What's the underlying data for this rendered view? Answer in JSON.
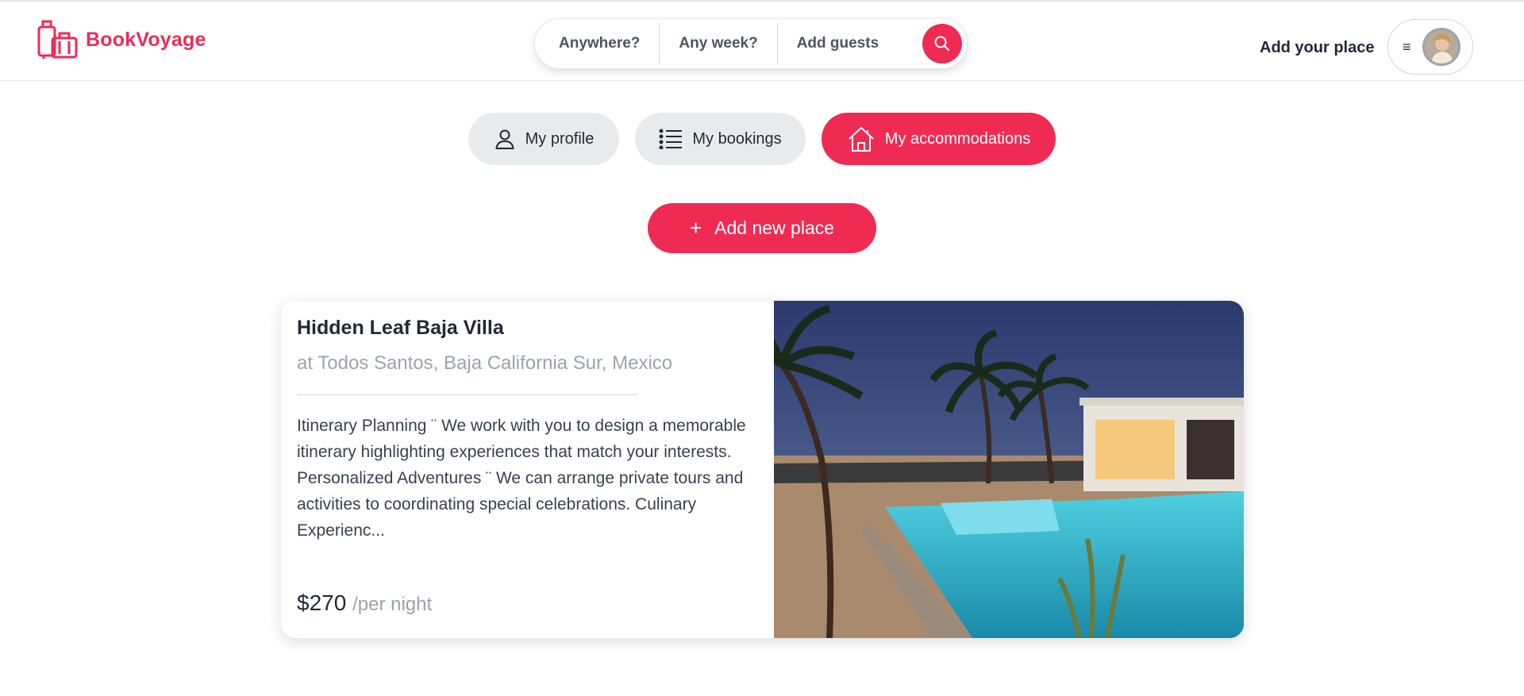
{
  "brand": {
    "name": "BookVoyage",
    "color": "#ef2b54"
  },
  "search": {
    "where": "Anywhere?",
    "when": "Any week?",
    "guests": "Add guests",
    "icon": "search-icon"
  },
  "header": {
    "add_place_link": "Add your place",
    "menu_icon": "≡"
  },
  "tabs": [
    {
      "label": "My profile",
      "icon": "user-icon",
      "active": false
    },
    {
      "label": "My bookings",
      "icon": "list-icon",
      "active": false
    },
    {
      "label": "My accommodations",
      "icon": "home-icon",
      "active": true
    }
  ],
  "add_new": {
    "label": "Add new place",
    "icon": "plus-icon",
    "symbol": "+"
  },
  "listing": {
    "title": "Hidden Leaf Baja Villa",
    "location": "at Todos Santos, Baja California Sur, Mexico",
    "description": "Itinerary Planning ¨ We work with you to design a memorable itinerary highlighting experiences that match your interests. Personalized Adventures ¨ We can arrange private tours and activities to coordinating special celebrations. Culinary Experienc...",
    "price": "$270",
    "per": "/per night"
  }
}
